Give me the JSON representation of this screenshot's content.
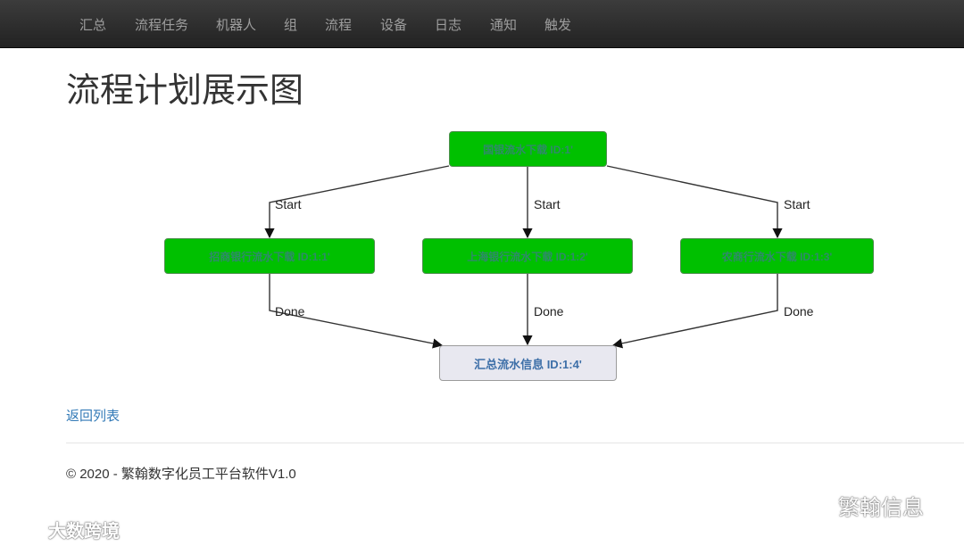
{
  "nav": {
    "items": [
      {
        "label": "汇总"
      },
      {
        "label": "流程任务"
      },
      {
        "label": "机器人"
      },
      {
        "label": "组"
      },
      {
        "label": "流程"
      },
      {
        "label": "设备"
      },
      {
        "label": "日志"
      },
      {
        "label": "通知"
      },
      {
        "label": "触发"
      }
    ]
  },
  "page": {
    "title": "流程计划展示图",
    "back_link": "返回列表",
    "footer": "© 2020 - 繁翰数字化员工平台软件V1.0"
  },
  "flow": {
    "nodes": [
      {
        "label": "国银流水下载 ID:1'",
        "status": "completed"
      },
      {
        "label": "招商银行流水下载 ID:1:1'",
        "status": "completed"
      },
      {
        "label": "上海银行流水下载 ID:1:2'",
        "status": "completed"
      },
      {
        "label": "农商行流水下载 ID:1:3'",
        "status": "completed"
      },
      {
        "label": "汇总流水信息 ID:1:4'",
        "status": "pending"
      }
    ],
    "edges": [
      {
        "from": 0,
        "to": 1,
        "label": "Start"
      },
      {
        "from": 0,
        "to": 2,
        "label": "Start"
      },
      {
        "from": 0,
        "to": 3,
        "label": "Start"
      },
      {
        "from": 1,
        "to": 4,
        "label": "Done"
      },
      {
        "from": 2,
        "to": 4,
        "label": "Done"
      },
      {
        "from": 3,
        "to": 4,
        "label": "Done"
      }
    ]
  },
  "watermarks": {
    "right": "繁翰信息",
    "left": "大数跨境"
  },
  "colors": {
    "navbar": "#222222",
    "node_completed": "#00c000",
    "node_pending": "#e8e8f0",
    "link": "#337ab7"
  },
  "icons": {
    "wechat": "wechat-icon",
    "watermark_logo": "watermark-logo-icon"
  }
}
